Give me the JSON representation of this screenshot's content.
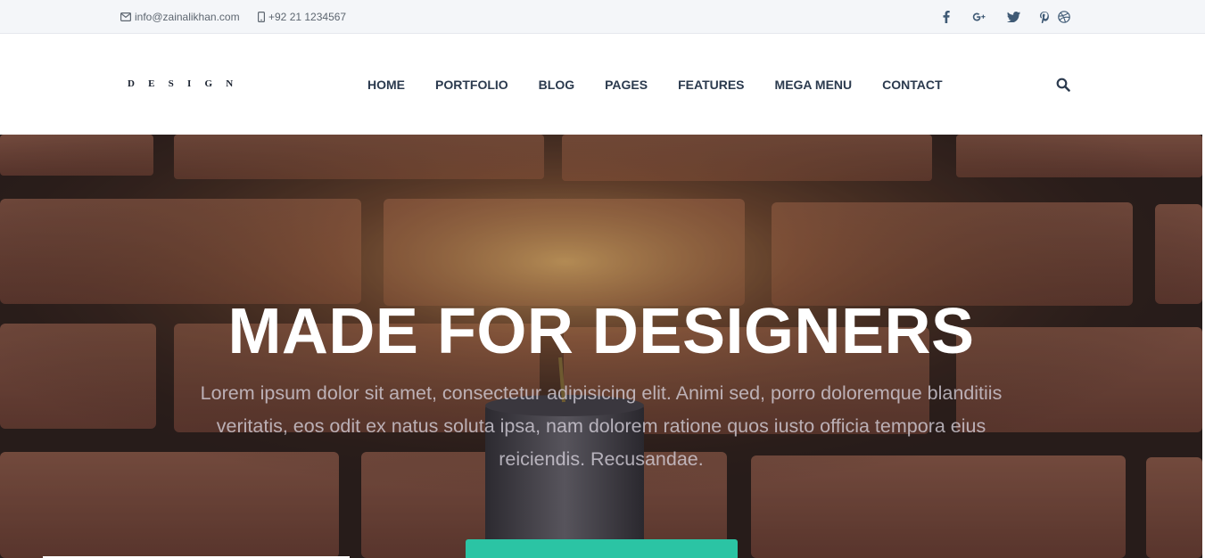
{
  "topbar": {
    "email": "info@zainalikhan.com",
    "phone": "+92 21 1234567",
    "socials": [
      "facebook-icon",
      "google-plus-icon",
      "twitter-icon",
      "pinterest-icon",
      "dribbble-icon"
    ]
  },
  "header": {
    "logo": "DESIGN",
    "nav": [
      "HOME",
      "PORTFOLIO",
      "BLOG",
      "PAGES",
      "FEATURES",
      "MEGA MENU",
      "CONTACT"
    ],
    "search_icon": "search-icon"
  },
  "hero": {
    "title": "MADE FOR DESIGNERS",
    "text": "Lorem ipsum dolor sit amet, consectetur adipisicing elit. Animi sed, porro doloremque blanditiis veritatis, eos odit ex natus soluta ipsa, nam dolorem ratione quos iusto officia tempora eius reiciendis. Recusandae.",
    "button_color": "#2bc4a4"
  },
  "colors": {
    "nav_text": "#2b3a4e",
    "accent": "#2bc4a4",
    "topbar_bg": "#f4f6f9"
  }
}
